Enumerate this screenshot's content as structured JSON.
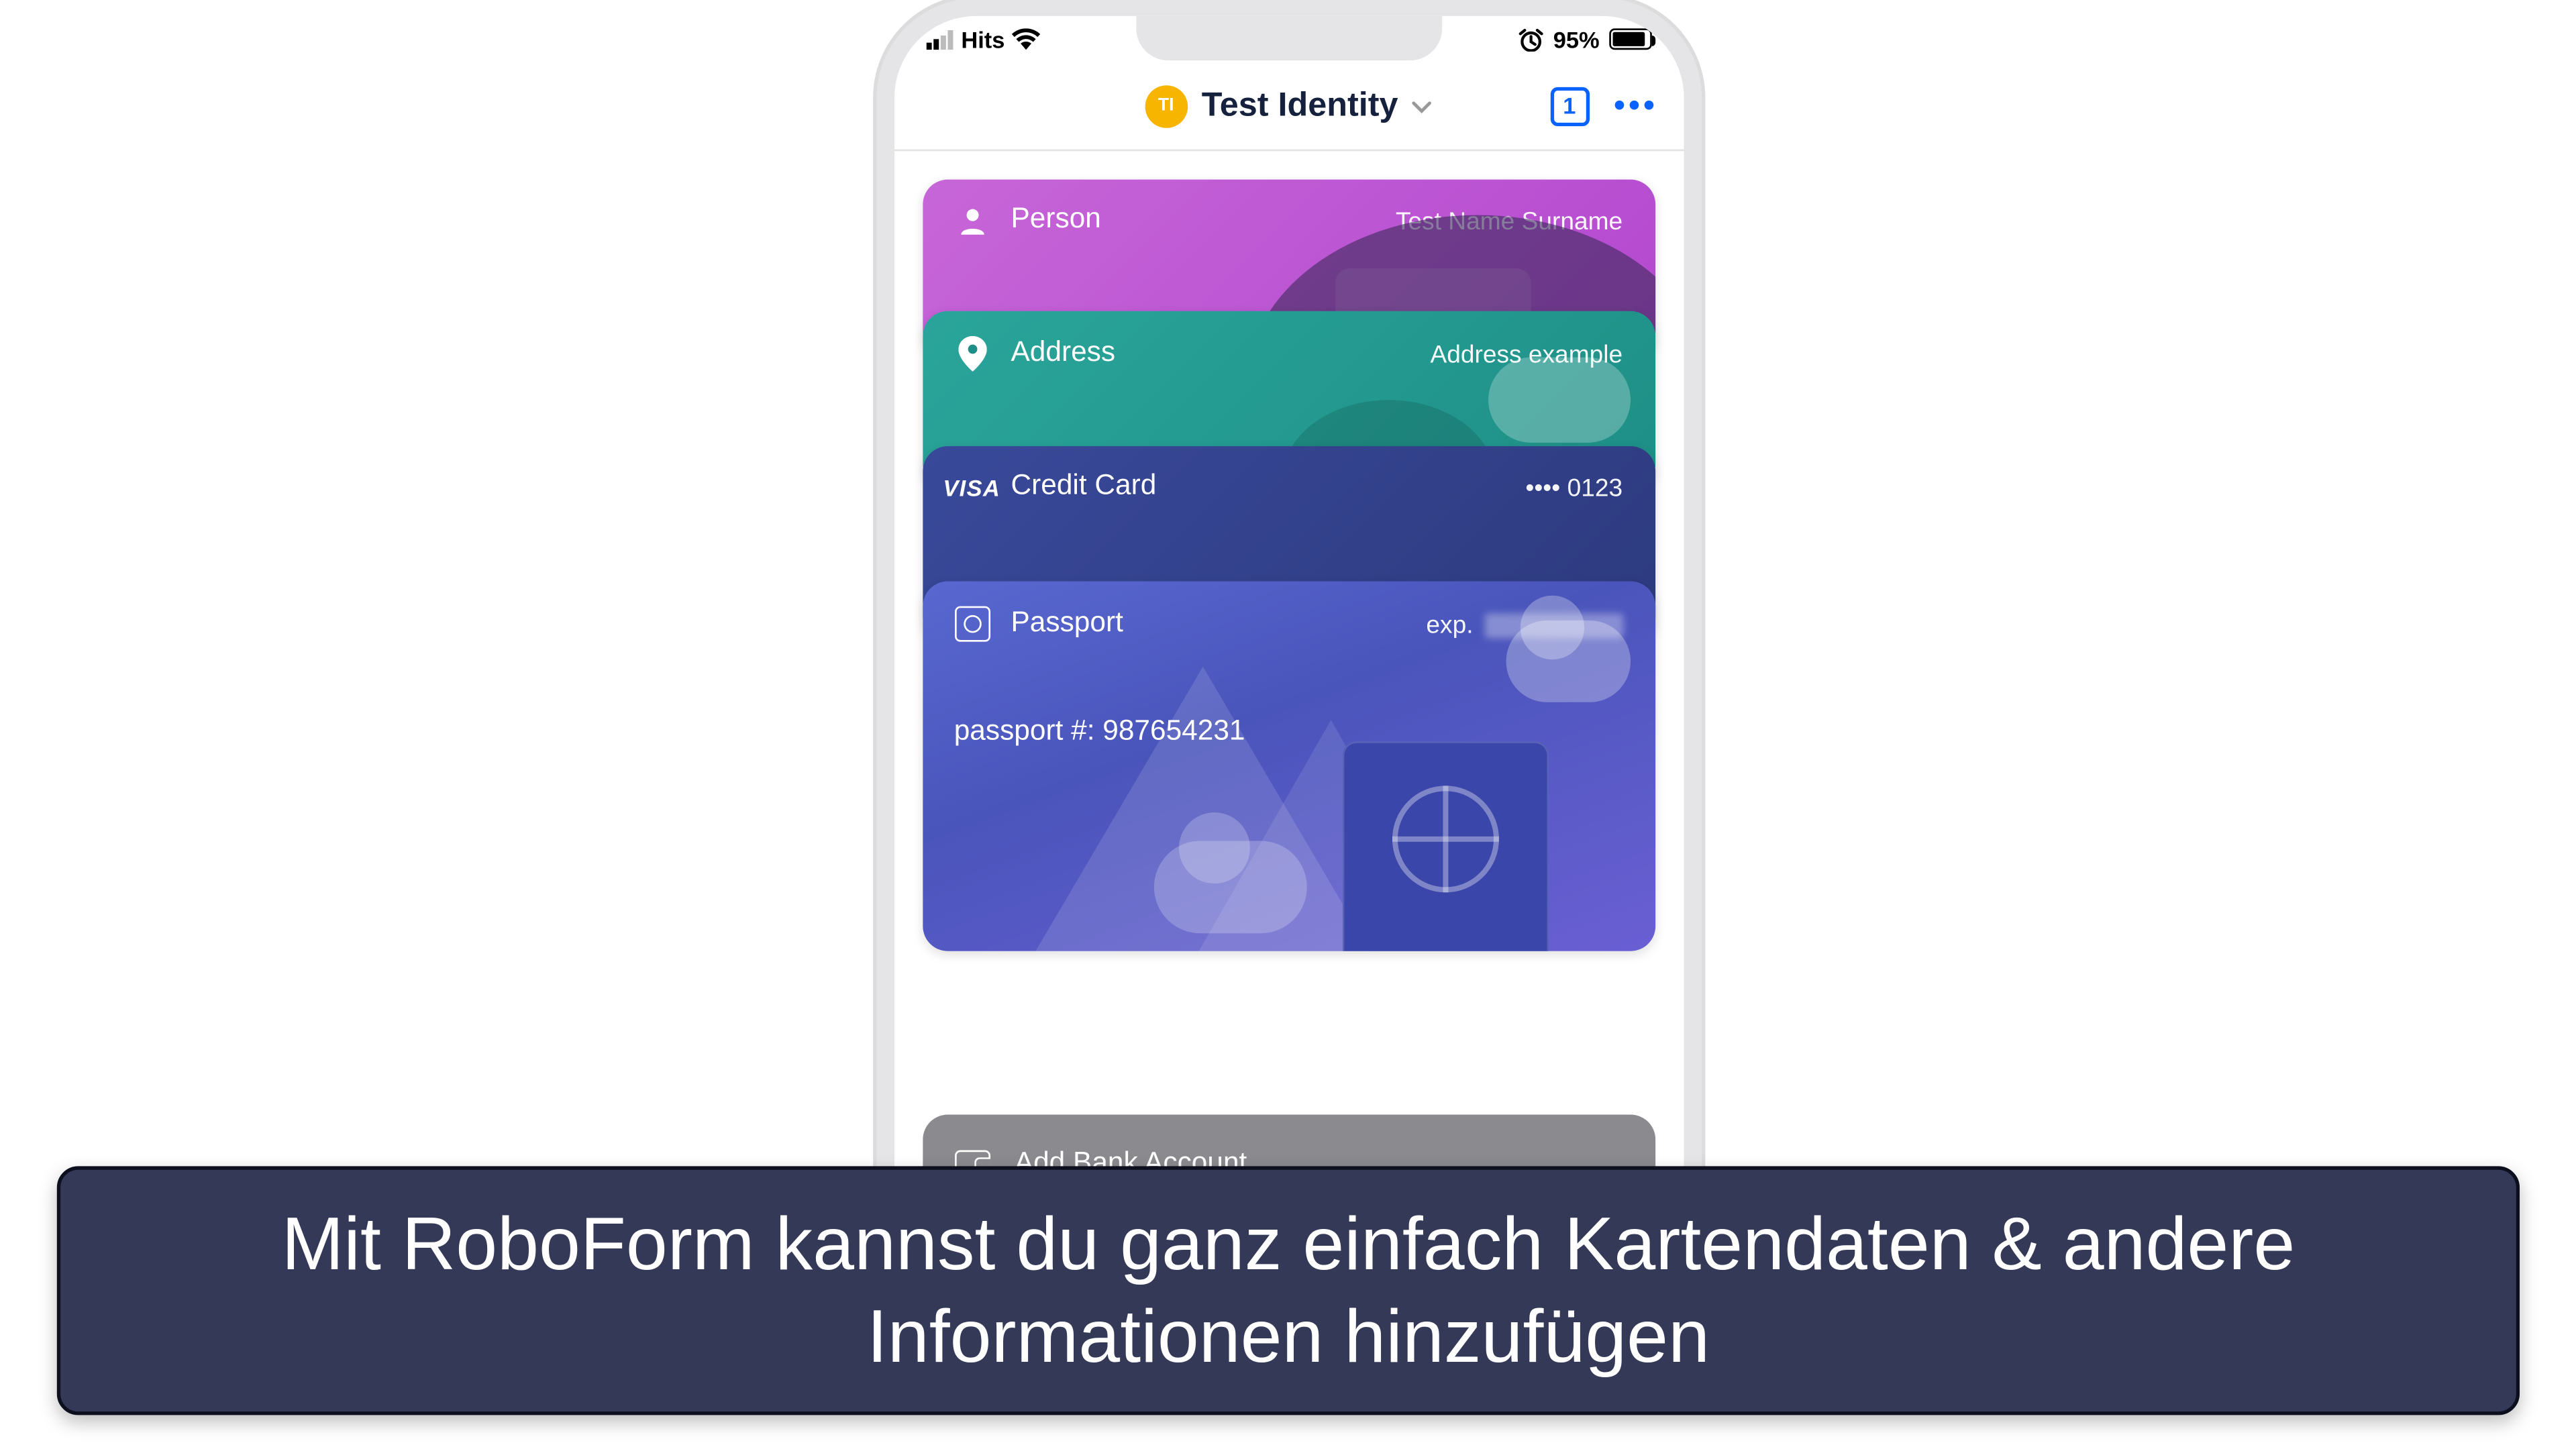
{
  "status_bar": {
    "carrier": "Hits",
    "battery_percent": "95%"
  },
  "header": {
    "avatar_initials": "TI",
    "identity_name": "Test Identity",
    "tab_count": "1"
  },
  "cards": {
    "person": {
      "title": "Person",
      "value": "Test Name Surname"
    },
    "address": {
      "title": "Address",
      "value": "Address example"
    },
    "credit": {
      "brand": "VISA",
      "title": "Credit Card",
      "value": "•••• 0123"
    },
    "passport": {
      "title": "Passport",
      "exp_label": "exp.",
      "number_line": "passport #: 987654231"
    }
  },
  "add_bank_label": "Add Bank Account",
  "caption": "Mit RoboForm kannst du ganz einfach Kartendaten & andere Informationen hinzufügen"
}
